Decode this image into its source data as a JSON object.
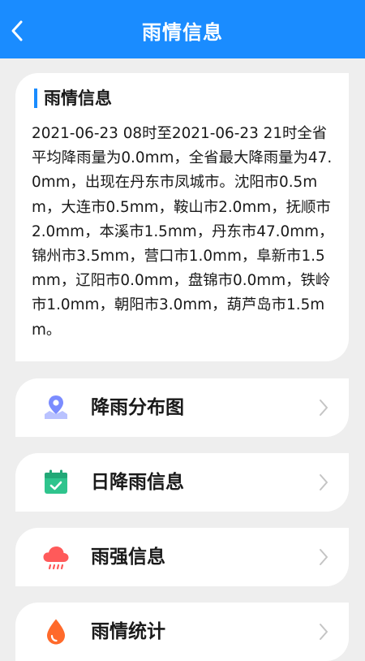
{
  "header": {
    "title": "雨情信息",
    "back_icon": "chevron-left-icon"
  },
  "info_card": {
    "title": "雨情信息",
    "summary": "2021-06-23 08时至2021-06-23 21时全省平均降雨量为0.0mm，全省最大降雨量为47.0mm，出现在丹东市凤城市。沈阳市0.5mm，大连市0.5mm，鞍山市2.0mm，抚顺市2.0mm，本溪市1.5mm，丹东市47.0mm，锦州市3.5mm，营口市1.0mm，阜新市1.5mm，辽阳市0.0mm，盘锦市0.0mm，铁岭市1.0mm，朝阳市3.0mm，葫芦岛市1.5mm。"
  },
  "menu": [
    {
      "label": "降雨分布图",
      "icon": "map-pin-icon"
    },
    {
      "label": "日降雨信息",
      "icon": "calendar-check-icon"
    },
    {
      "label": "雨强信息",
      "icon": "rain-cloud-icon"
    },
    {
      "label": "雨情统计",
      "icon": "water-drop-icon"
    }
  ],
  "colors": {
    "primary": "#1a8cff",
    "background": "#eeeeee",
    "card": "#ffffff",
    "icon_map": "#7b8cff",
    "icon_calendar": "#2fc48d",
    "icon_rain": "#ff5a5a",
    "icon_drop": "#ff6a2b"
  }
}
